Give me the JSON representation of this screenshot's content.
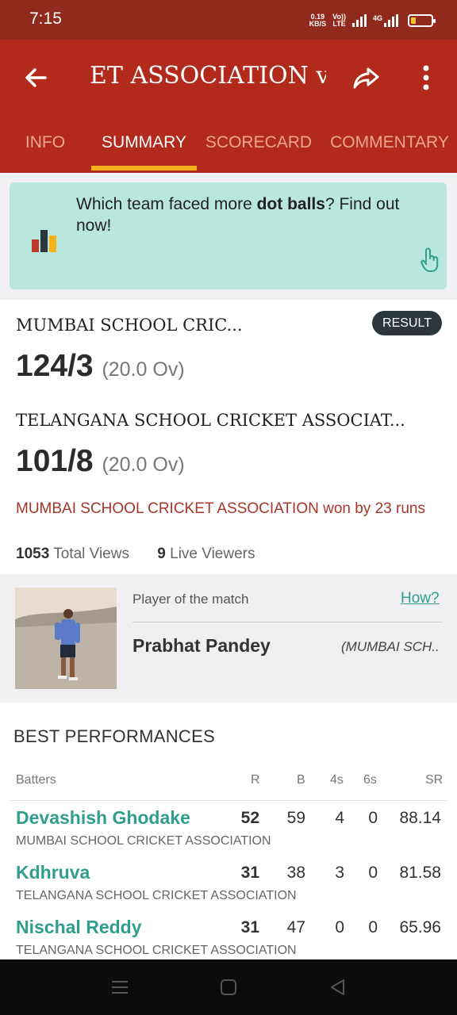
{
  "status_bar": {
    "time": "7:15",
    "net_speed_value": "0.19",
    "net_speed_unit": "KB/S",
    "volte_top": "Vo))",
    "volte_bottom": "LTE",
    "network_type": "4G",
    "battery_level": 0.25,
    "battery_color": "#f5c531"
  },
  "app_bar": {
    "title": "ET ASSOCIATION vs",
    "background": "#b12a1c",
    "tabs": [
      {
        "label": "INFO",
        "active": false
      },
      {
        "label": "SUMMARY",
        "active": true
      },
      {
        "label": "SCORECARD",
        "active": false
      },
      {
        "label": "COMMENTARY",
        "active": false
      }
    ],
    "indicator_color": "#f6b21b"
  },
  "promo": {
    "text_before": "Which team faced more ",
    "text_bold": "dot balls",
    "text_after": "? Find out now!",
    "icon": "bar-chart-icon",
    "tap_icon": "tap-hand-icon"
  },
  "match": {
    "badge": "RESULT",
    "team1": {
      "name": "MUMBAI SCHOOL CRIC...",
      "score": "124/3",
      "overs": "(20.0 Ov)"
    },
    "team2": {
      "name": "TELANGANA SCHOOL CRICKET ASSOCIAT...",
      "score": "101/8",
      "overs": "(20.0 Ov)"
    },
    "result_text": "MUMBAI SCHOOL CRICKET ASSOCIATION won by 23 runs",
    "total_views_count": "1053",
    "total_views_label": "Total Views",
    "live_viewers_count": "9",
    "live_viewers_label": "Live Viewers"
  },
  "potm": {
    "label": "Player of the match",
    "how_link": "How?",
    "name": "Prabhat Pandey",
    "team": "(MUMBAI SCH.."
  },
  "best_performances": {
    "title": "BEST PERFORMANCES",
    "headers": {
      "batters": "Batters",
      "r": "R",
      "b": "B",
      "fours": "4s",
      "sixes": "6s",
      "sr": "SR"
    },
    "batters": [
      {
        "name": "Devashish Ghodake",
        "team": "MUMBAI SCHOOL CRICKET ASSOCIATION",
        "r": "52",
        "b": "59",
        "fours": "4",
        "sixes": "0",
        "sr": "88.14"
      },
      {
        "name": "Kdhruva",
        "team": "TELANGANA SCHOOL CRICKET ASSOCIATION",
        "r": "31",
        "b": "38",
        "fours": "3",
        "sixes": "0",
        "sr": "81.58"
      },
      {
        "name": "Nischal Reddy",
        "team": "TELANGANA SCHOOL CRICKET ASSOCIATION",
        "r": "31",
        "b": "47",
        "fours": "0",
        "sixes": "0",
        "sr": "65.96"
      }
    ]
  },
  "nav_bar": {
    "icons": [
      "menu-icon",
      "home-icon",
      "back-triangle-icon"
    ]
  }
}
